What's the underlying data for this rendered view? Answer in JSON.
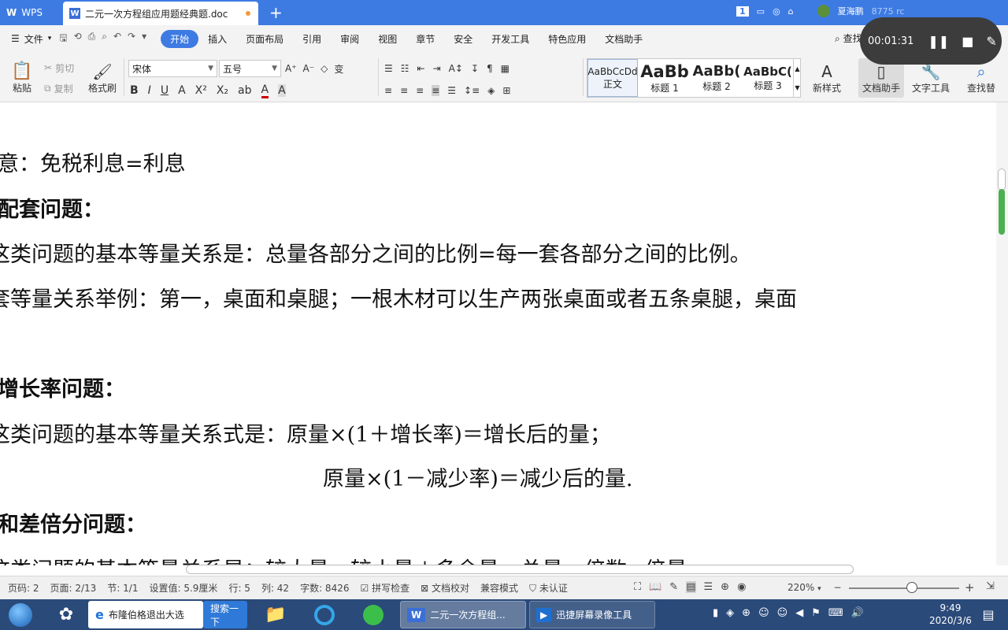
{
  "titlebar": {
    "app_tab": "WPS",
    "doc_tab": "二元一次方程组应用题经典题.doc",
    "new_tab": "+",
    "page_badge": "1",
    "user_name": "夏海鹏",
    "extra": "8775 rc"
  },
  "recorder": {
    "time": "00:01:31"
  },
  "menubar": {
    "file": "文件",
    "tabs": [
      "开始",
      "插入",
      "页面布局",
      "引用",
      "审阅",
      "视图",
      "章节",
      "安全",
      "开发工具",
      "特色应用",
      "文档助手"
    ],
    "search": "查找"
  },
  "ribbon": {
    "paste": "粘贴",
    "cut": "剪切",
    "copy": "复制",
    "format_painter": "格式刷",
    "font_name": "宋体",
    "font_size": "五号",
    "styles": [
      {
        "sample": "AaBbCcDd",
        "name": "正文"
      },
      {
        "sample": "AaBb",
        "name": "标题 1"
      },
      {
        "sample": "AaBb(",
        "name": "标题 2"
      },
      {
        "sample": "AaBbC(",
        "name": "标题 3"
      }
    ],
    "new_style": "新样式",
    "doc_helper": "文档助手",
    "text_tools": "文字工具",
    "find_replace": "查找替"
  },
  "document": {
    "lines": [
      {
        "text": "意：免税利息=利息",
        "bold": false
      },
      {
        "text": "配套问题：",
        "bold": true
      },
      {
        "text": "这类问题的基本等量关系是：总量各部分之间的比例=每一套各部分之间的比例。",
        "bold": false
      },
      {
        "text": "套等量关系举例：第一，桌面和桌腿；一根木材可以生产两张桌面或者五条桌腿，桌面",
        "bold": false
      },
      {
        "text": "增长率问题：",
        "bold": true
      },
      {
        "text": "这类问题的基本等量关系式是：原量×(1＋增长率)＝增长后的量；",
        "bold": false
      },
      {
        "text": "原量×(1－减少率)＝减少后的量.",
        "bold": false
      },
      {
        "text": "和差倍分问题：",
        "bold": true
      },
      {
        "text": "这类问题的基本等量关系是：较大量＝较小量＋多余量，总量＝倍数×倍量",
        "bold": false
      }
    ]
  },
  "statusbar": {
    "page_num": "页码: 2",
    "page_of": "页面: 2/13",
    "section": "节: 1/1",
    "position": "设置值: 5.9厘米",
    "row": "行: 5",
    "col": "列: 42",
    "word_count": "字数: 8426",
    "spell_check": "拼写检查",
    "doc_proof": "文档校对",
    "compat_mode": "兼容模式",
    "uncertified": "未认证",
    "zoom": "220%",
    "zoom_level": 0.57
  },
  "taskbar": {
    "ie_task": "布隆伯格退出大选",
    "search_btn": "搜索一下",
    "wps_task": "二元一次方程组...",
    "recorder_task": "迅捷屏幕录像工具",
    "time": "9:49",
    "date": "2020/3/6"
  }
}
